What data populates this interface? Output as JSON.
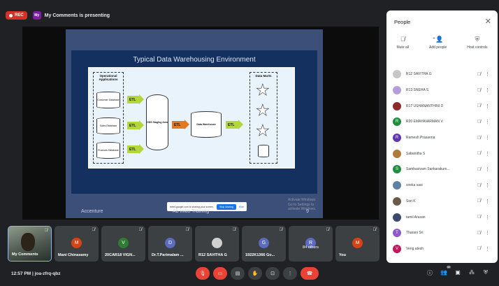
{
  "topbar": {
    "rec_label": "REC",
    "presenter_avatar": "My",
    "presenter_text": "My Comments is presenting"
  },
  "slide": {
    "title": "Typical Data Warehousing Environment",
    "operational_label": "Operational Applications",
    "sources": [
      "Customer Database",
      "Sales Database",
      "Products Database"
    ],
    "etl_label": "ETL",
    "staging_label": "ODS Staging Area",
    "warehouse_label": "Data Warehouse",
    "data_marts_label": "Data Marts",
    "footer_left": "Accenture",
    "footer_center": "Ab Initio Training",
    "footer_right": "9",
    "watermark_line1": "Activate Windows",
    "watermark_line2": "Go to Settings to activate Windows."
  },
  "share_bar": {
    "text": "meet.google.com is sharing your screen.",
    "stop_label": "Stop sharing",
    "hide_label": "Hide"
  },
  "people_panel": {
    "title": "People",
    "close_icon": "close-icon",
    "actions": [
      {
        "label": "Mute all",
        "icon": "mic-off-icon"
      },
      {
        "label": "Add people",
        "icon": "add-person-icon"
      },
      {
        "label": "Host controls",
        "icon": "shield-lock-icon"
      }
    ],
    "participants": [
      {
        "name": "R12 SAVITHA G",
        "initial": "",
        "color": "#c7c7c7"
      },
      {
        "name": "R13 SNEHA S",
        "initial": "",
        "color": "#b39ddb"
      },
      {
        "name": "R17 USHANANTHINI D",
        "initial": "",
        "color": "#8d2a2a"
      },
      {
        "name": "R20 EMAYAVARMAN V",
        "initial": "R",
        "color": "#1e8e3e"
      },
      {
        "name": "Ramesh Prasanna",
        "initial": "R",
        "color": "#5e35b1"
      },
      {
        "name": "Sabanitha S",
        "initial": "",
        "color": "#b07a3a"
      },
      {
        "name": "Sambasivam Sankarakum...",
        "initial": "S",
        "color": "#1e8e3e"
      },
      {
        "name": "sneka sasi",
        "initial": "",
        "color": "#5f7fa3"
      },
      {
        "name": "Sori K",
        "initial": "",
        "color": "#6a5a4a"
      },
      {
        "name": "tamil Arasan",
        "initial": "",
        "color": "#3b4a6b"
      },
      {
        "name": "Tharani Sri",
        "initial": "T",
        "color": "#8e5ac8"
      },
      {
        "name": "Veng atesh",
        "initial": "V",
        "color": "#c2185b"
      }
    ]
  },
  "tiles": [
    {
      "name": "My Comments",
      "type": "camera"
    },
    {
      "name": "Mani Chinasamy",
      "initial": "M",
      "color": "#d84315"
    },
    {
      "name": "20CAR18 VIGN...",
      "initial": "V",
      "color": "#2e7d32"
    },
    {
      "name": "Dr.T.Parimalam ...",
      "initial": "D",
      "color": "#5c6bc0"
    },
    {
      "name": "R12 SAVITHA G",
      "initial": "",
      "color": "#d0d0d0"
    },
    {
      "name": "1922K1366 Go...",
      "initial": "G",
      "color": "#5c6bc0"
    },
    {
      "name": "84 others",
      "initial": "R",
      "color": "#5c6bc0"
    },
    {
      "name": "You",
      "initial": "M",
      "color": "#d84315"
    }
  ],
  "bottom": {
    "clock": "12:57 PM",
    "meeting_code": "joa-zfrq-qbz",
    "participants_badge": "92"
  }
}
